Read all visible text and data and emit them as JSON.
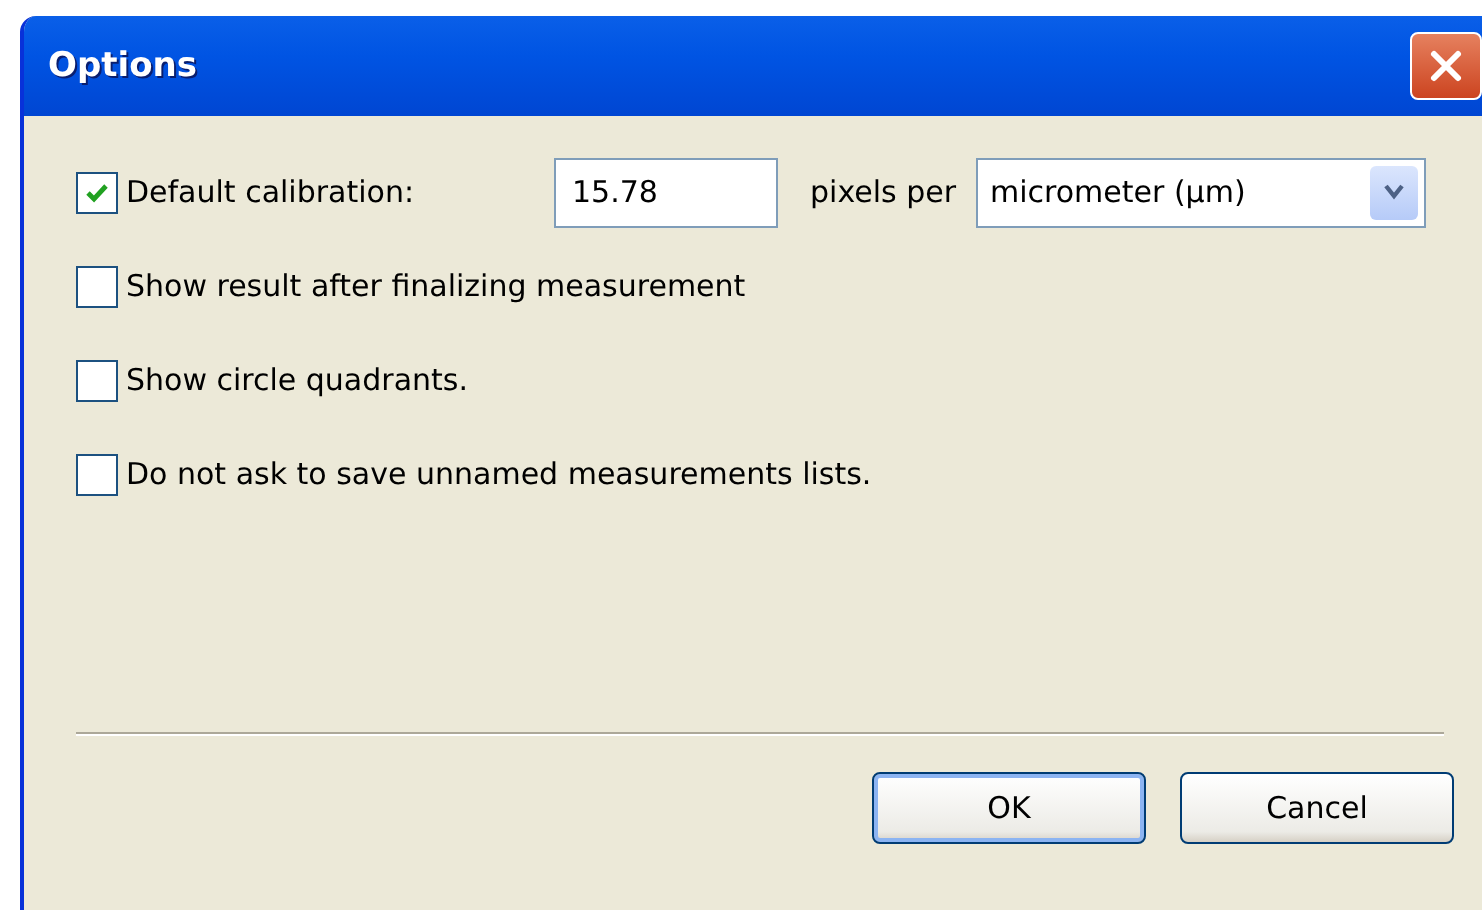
{
  "window": {
    "title": "Options"
  },
  "options": [
    {
      "kind": "calibration",
      "label": "Default calibration:",
      "checked": true,
      "value": "15.78",
      "unit_label": "pixels per",
      "unit": "micrometer (µm)"
    },
    {
      "kind": "plain",
      "label": "Show result after finalizing measurement",
      "checked": false
    },
    {
      "kind": "plain",
      "label": "Show circle quadrants.",
      "checked": false
    },
    {
      "kind": "plain",
      "label": "Do not ask to save unnamed measurements lists.",
      "checked": false
    }
  ],
  "buttons": [
    {
      "label": "OK",
      "default": true
    },
    {
      "label": "Cancel",
      "default": false
    }
  ]
}
